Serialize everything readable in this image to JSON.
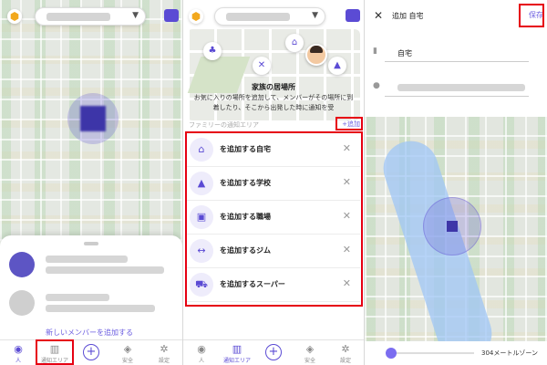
{
  "colors": {
    "accent": "#5b4bd4",
    "highlight": "#e60012"
  },
  "screen1": {
    "add_member": "新しいメンバーを追加する",
    "nav": [
      {
        "icon": "person-icon",
        "label": "人"
      },
      {
        "icon": "building-icon",
        "label": "通知エリア"
      },
      {
        "icon": "plus-icon",
        "label": ""
      },
      {
        "icon": "shield-icon",
        "label": "安全"
      },
      {
        "icon": "gear-icon",
        "label": "設定"
      }
    ]
  },
  "screen2": {
    "card_title": "家族の居場所",
    "card_desc": "お気に入りの場所を追加して、メンバーがその場所に到着したり、そこから出発した時に通知を受",
    "section": "ファミリーの通知エリア",
    "add": "+追加",
    "places": [
      {
        "icon": "home-icon",
        "label": "を追加する自宅"
      },
      {
        "icon": "school-icon",
        "label": "を追加する学校"
      },
      {
        "icon": "briefcase-icon",
        "label": "を追加する職場"
      },
      {
        "icon": "dumbbell-icon",
        "label": "を追加するジム"
      },
      {
        "icon": "cart-icon",
        "label": "を追加するスーパー"
      }
    ],
    "nav": [
      {
        "icon": "person-icon",
        "label": "人"
      },
      {
        "icon": "building-icon",
        "label": "通知エリア"
      },
      {
        "icon": "plus-icon",
        "label": ""
      },
      {
        "icon": "shield-icon",
        "label": "安全"
      },
      {
        "icon": "gear-icon",
        "label": "設定"
      }
    ]
  },
  "screen3": {
    "title": "追加 自宅",
    "save": "保存",
    "name_value": "自宅",
    "zone_label": "304メートルゾーン",
    "zone_level": 0.05
  }
}
